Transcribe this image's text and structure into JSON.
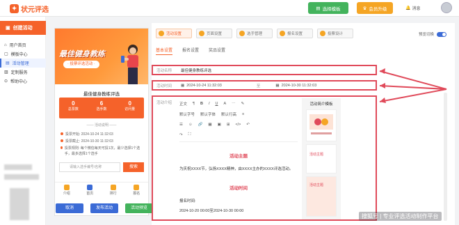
{
  "header": {
    "logo_text": "状元评选",
    "template_btn": "选择模板",
    "vip_btn": "会员升级",
    "message": "消息"
  },
  "sidebar": {
    "create_btn": "创建活动",
    "items": [
      {
        "label": "用户首页",
        "icon": "home-icon"
      },
      {
        "label": "模板中心",
        "icon": "template-icon"
      },
      {
        "label": "活动管理",
        "icon": "activity-icon",
        "active": true
      },
      {
        "label": "定制服务",
        "icon": "custom-icon"
      },
      {
        "label": "帮助中心",
        "icon": "help-icon"
      }
    ]
  },
  "phone": {
    "banner_title": "最佳健身教练",
    "banner_sub": "· 投票评选活动 ·",
    "title": "最佳健身教练评选",
    "stats": [
      {
        "value": "0",
        "label": "总票数"
      },
      {
        "value": "6",
        "label": "选手数"
      },
      {
        "value": "0",
        "label": "访问量"
      }
    ],
    "section_label": "—— 活动说明 ——",
    "info": [
      "投票开始: 2024-10-24 11:32:03",
      "投票截止: 2024-10-30 11:32:03",
      "投票规则: 每个微信每天可投1次，最少选择1个选手，最多选择1个选手"
    ],
    "search_placeholder": "请输入选手编号/名称",
    "search_btn": "搜索",
    "tabs": [
      "介绍",
      "首页",
      "排行",
      "报名"
    ]
  },
  "bottom_buttons": {
    "cancel": "取消",
    "publish": "发布活动",
    "preview": "活动预览"
  },
  "editor": {
    "steps": [
      "活动设置",
      "页面设置",
      "选手管理",
      "报名设置",
      "投票设计"
    ],
    "preview_label": "预览切换",
    "sub_tabs": [
      "基本设置",
      "报名设置",
      "奖品设置"
    ],
    "name_label": "活动名称",
    "name_value": "最佳健身教练评选",
    "time_label": "活动时间",
    "time_start": "2024-10-24 11:32:03",
    "time_sep": "至",
    "time_end": "2024-10-30 11:32:03",
    "intro_label": "活动介绍",
    "toolbar_rows": [
      [
        "正文",
        "¶",
        "B",
        "I",
        "U",
        "A",
        "⋯",
        "✎"
      ],
      [
        "默认字号",
        "默认字体",
        "默认行高",
        "≡"
      ],
      [
        "☰",
        "☺",
        "🔗",
        "▦",
        "▣",
        "⊞",
        "</>",
        "↶"
      ],
      [
        "↷",
        "⛶"
      ]
    ],
    "doc_heading_1": "活动主题",
    "doc_text_1": "为庆祝XXXX节，弘扬XXXX精神，由XXXX主办的XXXX评选活动。",
    "doc_heading_2": "活动时间",
    "doc_text_2": "报名时间:",
    "doc_text_3": "2024-10-20 00:00至2024-10-30 00:00",
    "template_panel_title": "活动简介模板",
    "template_cards": [
      "活动主题",
      "活动主题"
    ],
    "watermark": "搜狐号 | 专业评选活动制作平台"
  },
  "colors": {
    "brand": "#f5622a",
    "green": "#43b35c",
    "vip": "#f5a524",
    "blue": "#3b6bd6",
    "highlight": "#e04a5a"
  }
}
